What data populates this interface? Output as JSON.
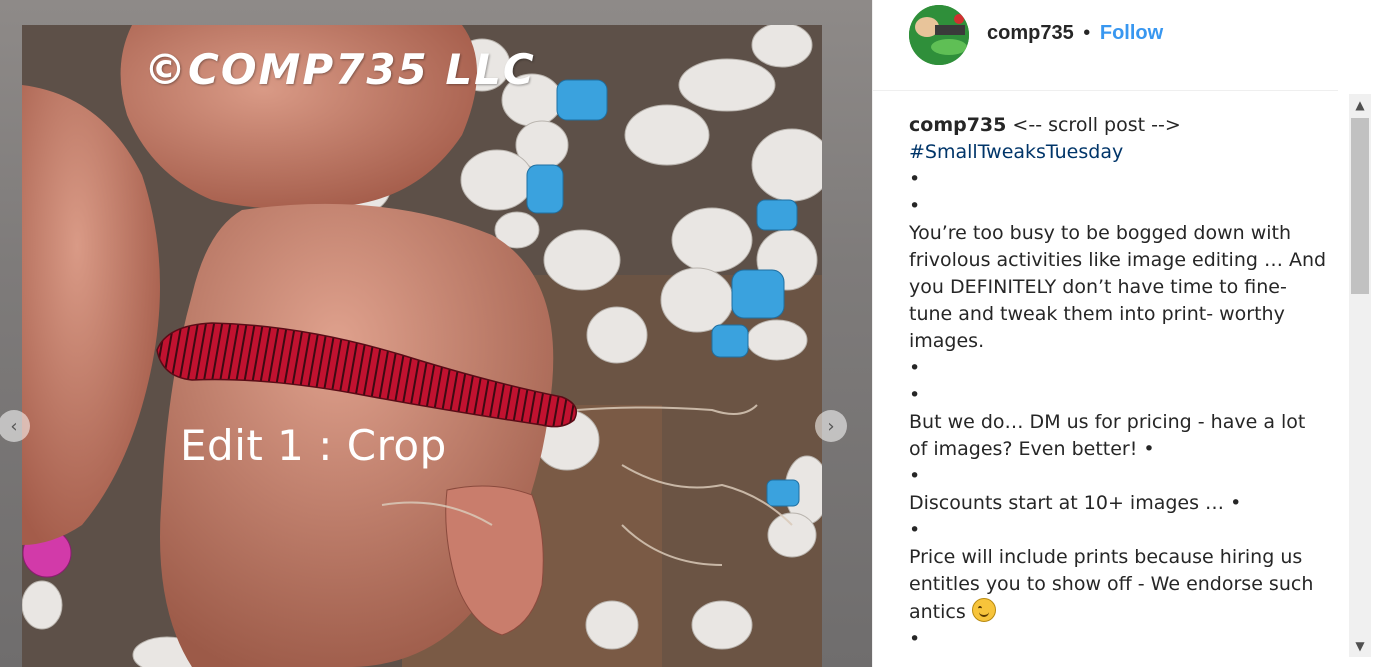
{
  "post": {
    "watermark": "©COMP735 LLC",
    "overlay_caption": "Edit 1 : Crop",
    "prev_label": "‹",
    "next_label": "›"
  },
  "header": {
    "username": "comp735",
    "separator": "•",
    "follow_label": "Follow"
  },
  "caption": {
    "author": "comp735",
    "first_line": " <-- scroll post -->",
    "hashtag": "#SmallTweaksTuesday",
    "lines": [
      "•",
      "•",
      "You’re too busy to be bogged down with frivolous activities like image editing … And you DEFINITELY don’t have time to fine- tune and tweak them into print- worthy images.",
      "•",
      "•",
      "But we do… DM us for pricing - have a lot of images? Even better! •",
      "•",
      "Discounts start at 10+ images … •",
      "•",
      "Price will include prints because hiring us entitles you to show off - We endorse such antics",
      "•"
    ],
    "emoji_name": "smirking-face-emoji"
  },
  "scrollbar": {
    "up_label": "▲",
    "down_label": "▼"
  },
  "colors": {
    "follow": "#3897f0",
    "hashtag": "#003569",
    "text": "#262626"
  }
}
